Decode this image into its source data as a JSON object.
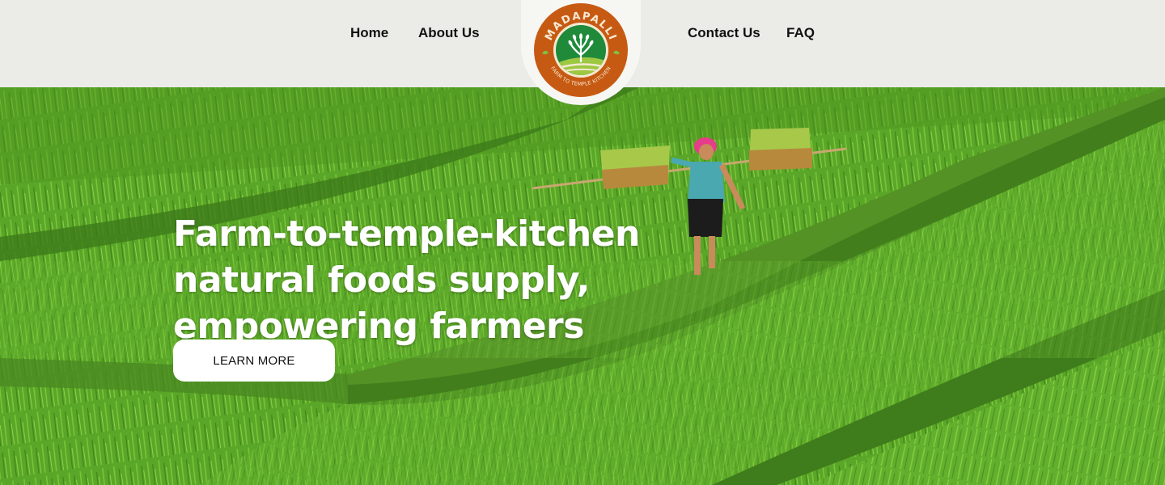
{
  "nav": {
    "left": [
      {
        "label": "Home"
      },
      {
        "label": "About Us"
      }
    ],
    "right": [
      {
        "label": "Contact Us"
      },
      {
        "label": "FAQ"
      }
    ]
  },
  "logo": {
    "brand": "MADAPALLI",
    "tagline": "FARM TO TEMPLE KITCHEN",
    "colors": {
      "ring": "#c75a12",
      "inner": "#1f8a3a",
      "cream": "#f5e9d2"
    }
  },
  "hero": {
    "title_lines": [
      "Farm-to-temple-kitchen",
      "natural foods supply,",
      "empowering farmers"
    ],
    "cta_label": "LEARN MORE",
    "image": "rice-terrace-farmer-photo"
  }
}
